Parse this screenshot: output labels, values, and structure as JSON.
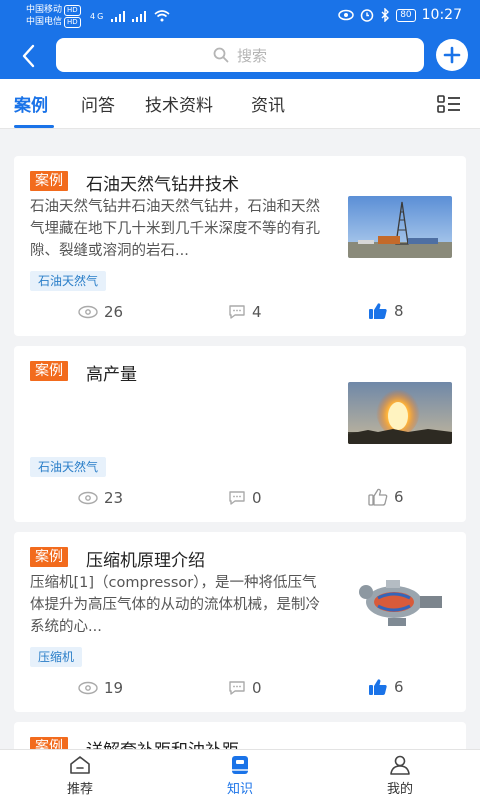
{
  "status_bar": {
    "carrier1": "中国移动",
    "carrier2": "中国电信",
    "hd": "HD",
    "network": "4G",
    "battery": "80",
    "time": "10:27"
  },
  "search": {
    "placeholder": "搜索"
  },
  "tabs": [
    {
      "label": "案例",
      "active": true
    },
    {
      "label": "问答"
    },
    {
      "label": "技术资料"
    },
    {
      "label": "资讯"
    }
  ],
  "cards": [
    {
      "tag": "案例",
      "title": "石油天然气钻井技术",
      "desc": "石油天然气钻井石油天然气钻井，石油和天然气埋藏在地下几十米到几千米深度不等的有孔隙、裂缝或溶洞的岩石...",
      "chip": "石油天然气",
      "views": "26",
      "comments": "4",
      "likes": "8",
      "liked": true
    },
    {
      "tag": "案例",
      "title": "高产量",
      "desc": "",
      "chip": "石油天然气",
      "views": "23",
      "comments": "0",
      "likes": "6",
      "liked": false
    },
    {
      "tag": "案例",
      "title": "压缩机原理介绍",
      "desc": "压缩机[1]（compressor），是一种将低压气体提升为高压气体的从动的流体机械，是制冷系统的心...",
      "chip": "压缩机",
      "views": "19",
      "comments": "0",
      "likes": "6",
      "liked": true
    },
    {
      "tag": "案例",
      "title": "详解套补距和油补距"
    }
  ],
  "bottom_nav": [
    {
      "label": "推荐",
      "icon": "home-icon"
    },
    {
      "label": "知识",
      "icon": "book-icon",
      "active": true
    },
    {
      "label": "我的",
      "icon": "user-icon"
    }
  ],
  "colors": {
    "primary": "#1a73e8",
    "tag": "#f26b1d"
  }
}
